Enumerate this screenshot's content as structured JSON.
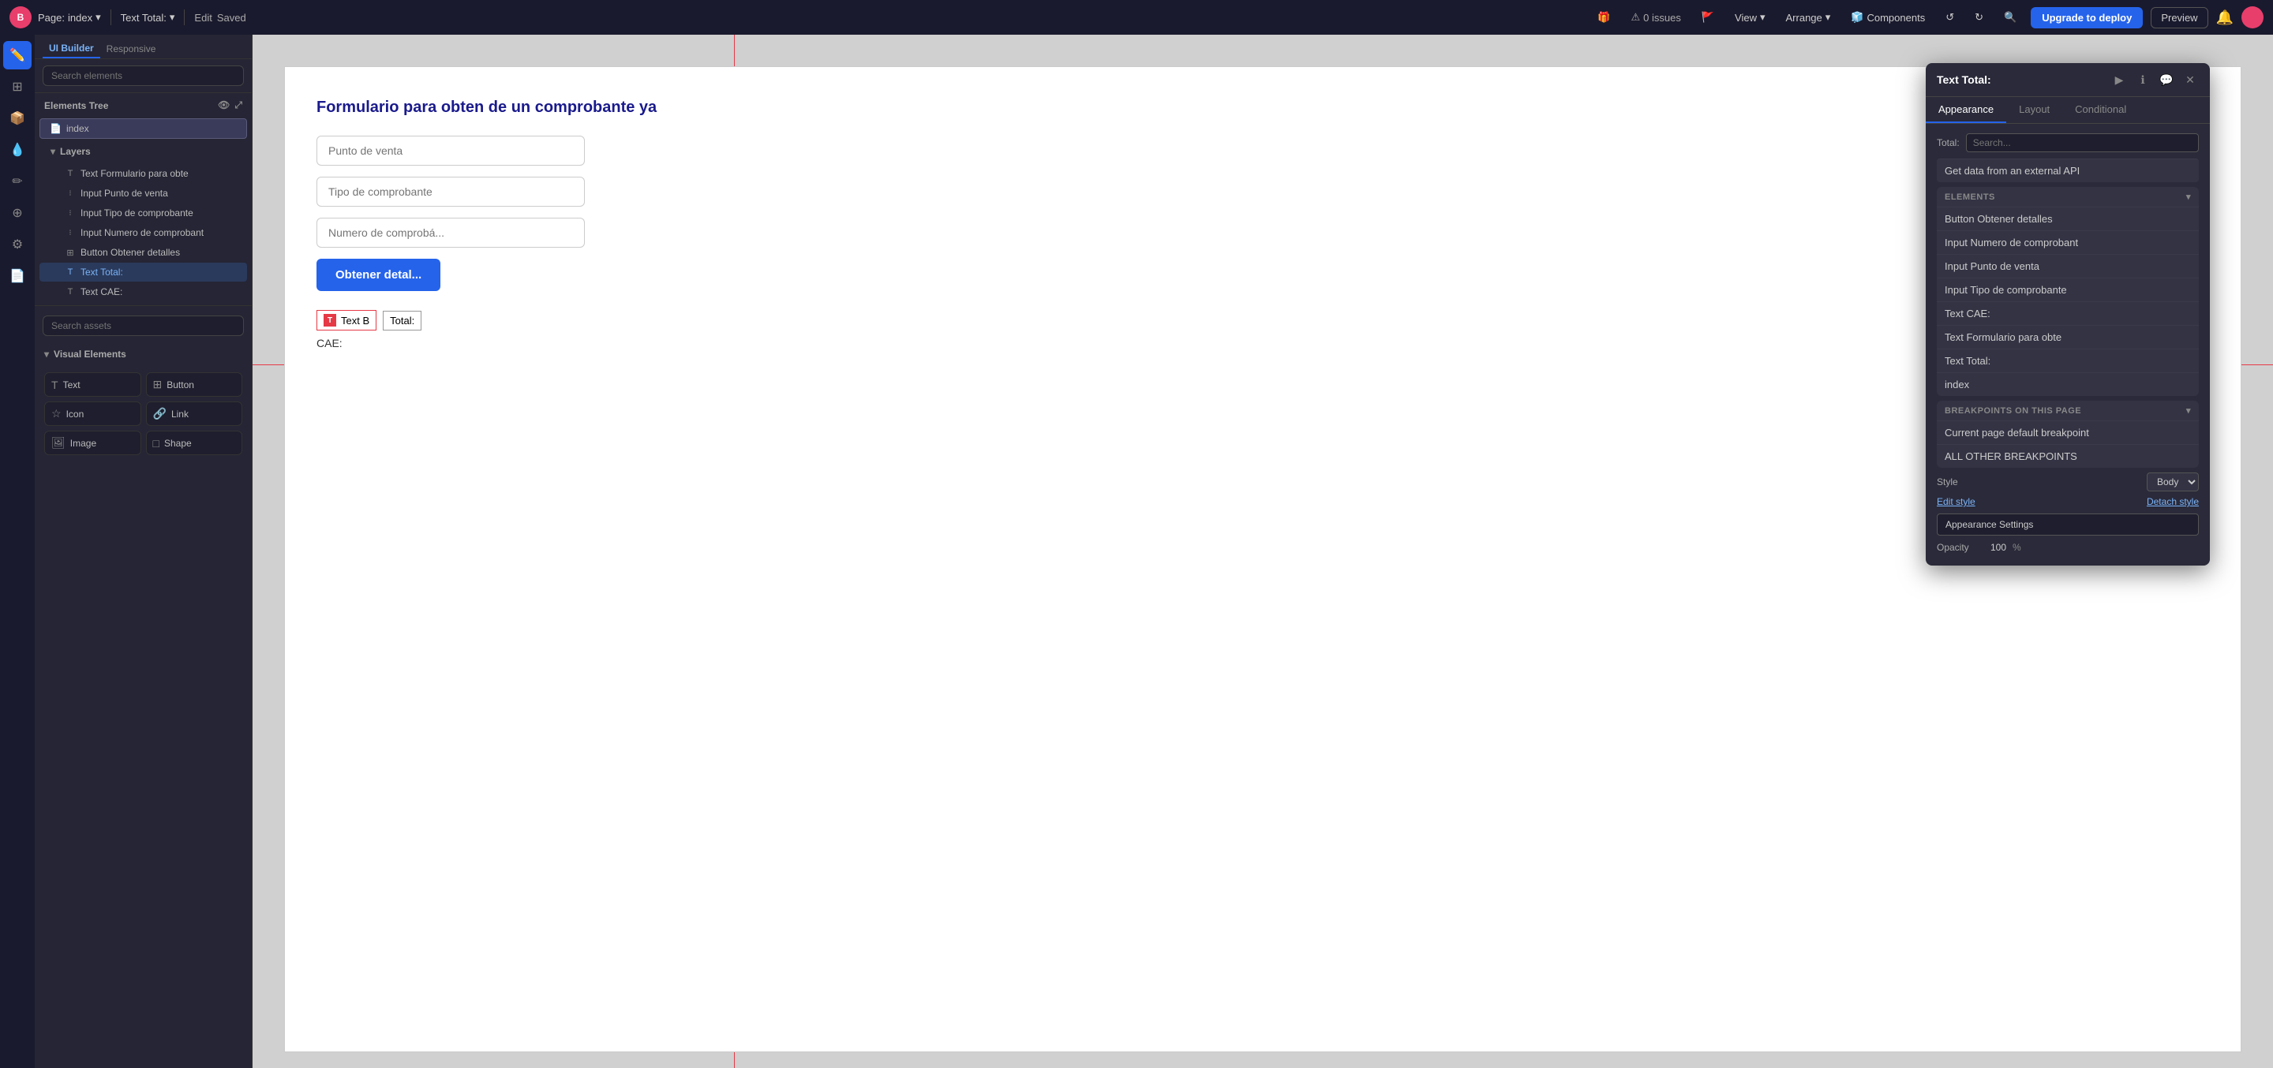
{
  "topbar": {
    "logo": "B",
    "page_label": "Page:",
    "page_name": "index",
    "text_total_label": "Text Total:",
    "edit_label": "Edit",
    "saved_label": "Saved",
    "issues_count": "0 issues",
    "view_label": "View",
    "arrange_label": "Arrange",
    "components_label": "Components",
    "upgrade_label": "Upgrade to deploy",
    "preview_label": "Preview"
  },
  "left_nav": {
    "icons": [
      "✏️",
      "⊞",
      "📦",
      "💧",
      "✏",
      "⊕",
      "⚙",
      "📄"
    ]
  },
  "left_panel": {
    "search_placeholder": "Search elements",
    "elements_tree_label": "Elements Tree",
    "index_item": "index",
    "layers_label": "Layers",
    "tree_items": [
      {
        "icon": "T",
        "label": "Text Formulario para obte",
        "indent": 1
      },
      {
        "icon": "I",
        "label": "Input Punto de venta",
        "indent": 1
      },
      {
        "icon": "I",
        "label": "Input Tipo de comprobante",
        "indent": 1
      },
      {
        "icon": "I",
        "label": "Input Numero de comprobant",
        "indent": 1
      },
      {
        "icon": "⊞",
        "label": "Button Obtener detalles",
        "indent": 1
      },
      {
        "icon": "T",
        "label": "Text Total:",
        "indent": 1,
        "active": true
      },
      {
        "icon": "T",
        "label": "Text CAE:",
        "indent": 1
      }
    ],
    "search_assets_placeholder": "Search assets",
    "visual_elements_label": "Visual Elements",
    "visual_items": [
      {
        "icon": "T",
        "label": "Text"
      },
      {
        "icon": "⊞",
        "label": "Button"
      },
      {
        "icon": "☆",
        "label": "Icon"
      },
      {
        "icon": "🔗",
        "label": "Link"
      },
      {
        "icon": "🖼",
        "label": "Image"
      },
      {
        "icon": "□",
        "label": "Shape"
      }
    ]
  },
  "canvas": {
    "form_title": "Formulario para obten de un comprobante ya",
    "input_placeholder_1": "Punto de venta",
    "input_placeholder_2": "Tipo de comprobante",
    "input_placeholder_3": "Numero de comprobá...",
    "obtain_btn_label": "Obtener detal...",
    "text_b_label": "Text B",
    "total_label": "Total:",
    "cae_label": "CAE:",
    "dim_513": "513px",
    "dim_520": "520px",
    "dim_234": "234px"
  },
  "right_panel": {
    "title": "Text Total:",
    "tabs": [
      "Appearance",
      "Layout",
      "Conditional"
    ],
    "active_tab": "Appearance",
    "total_label": "Total:",
    "search_placeholder": "Search...",
    "external_api_label": "Get data from an external API",
    "sections": {
      "elements": {
        "header": "ELEMENTS",
        "items": [
          "Button Obtener detalles",
          "Input Numero de comprobant",
          "Input Punto de venta",
          "Input Tipo de comprobante",
          "Text CAE:",
          "Text Formulario para obte",
          "Text Total:",
          "index"
        ]
      },
      "breakpoints": {
        "header": "BREAKPOINTS ON THIS PAGE",
        "items": [
          "Current page default breakpoint",
          "ALL OTHER BREAKPOINTS"
        ]
      }
    },
    "style_label": "Style",
    "body_label": "Body",
    "edit_style_label": "Edit style",
    "detach_style_label": "Detach style",
    "appearance_settings_label": "Appearance Settings",
    "opacity_label": "Opacity",
    "opacity_value": "100",
    "opacity_unit": "%"
  }
}
